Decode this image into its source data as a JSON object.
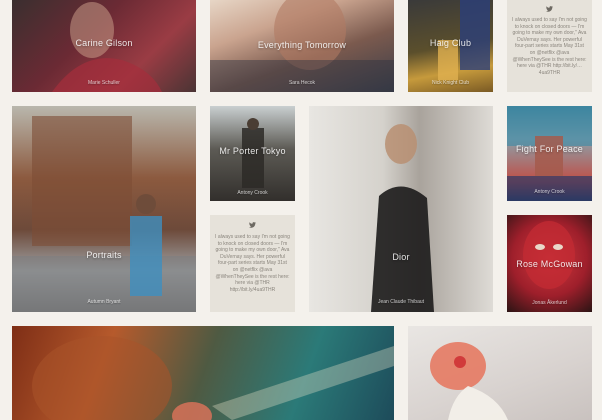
{
  "tiles": {
    "carine": {
      "title": "Carine Gilson",
      "credit": "Marie Schuller"
    },
    "everything": {
      "title": "Everything Tomorrow",
      "credit": "Sara Hecok"
    },
    "haig": {
      "title": "Haig Club",
      "credit": "Nick Knight Club"
    },
    "portraits": {
      "title": "Portraits",
      "credit": "Autumn Bryant"
    },
    "mrporter": {
      "title": "Mr Porter Tokyo",
      "credit": "Antony Crook"
    },
    "dior": {
      "title": "Dior",
      "credit": "Jean Claude Thibaut"
    },
    "fight": {
      "title": "Fight For Peace",
      "credit": "Antony Crook"
    },
    "rose": {
      "title": "Rose McGowan",
      "credit": "Jonas Åkerlund"
    }
  },
  "tweets": {
    "top": {
      "icon": "twitter-bird-icon",
      "text": "I always used to say I'm not going to knock on closed doors — I'm going to make my own door,\" Ava DuVernay says. Her powerful four-part series starts May 31st on @netflix @ava @WhenTheySee is the rest here: here via @THR http://bit.ly/…4ua9THR"
    },
    "middle": {
      "icon": "twitter-bird-icon",
      "text": "I always used to say I'm not going to knock on closed doors — I'm going to make my own door,\" Ava DuVernay says. Her powerful four-part series starts May 31st on @netflix @ava @WhenTheySee is the rest here: here via @THR http://bit.ly/4ua9THR"
    }
  },
  "colors": {
    "background": "#f4f1ec",
    "tweet_bg": "#e6e2da",
    "tweet_text": "#8a857d"
  }
}
